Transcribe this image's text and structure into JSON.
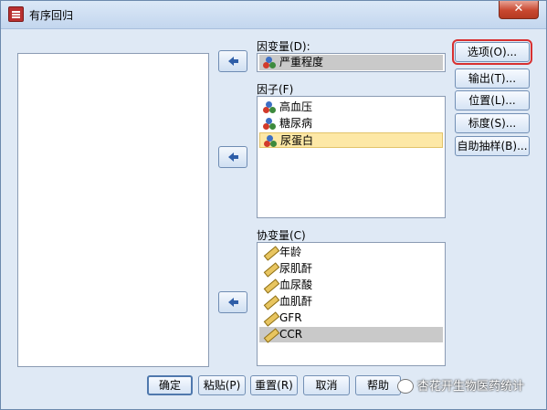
{
  "window": {
    "title": "有序回归",
    "close_label": "✕"
  },
  "dependent": {
    "label": "因变量(D):",
    "item": {
      "label": "严重程度",
      "icon": "nominal-icon"
    }
  },
  "factors": {
    "label": "因子(F)",
    "items": [
      {
        "label": "高血压",
        "icon": "nominal-icon"
      },
      {
        "label": "糖尿病",
        "icon": "nominal-icon"
      },
      {
        "label": "尿蛋白",
        "icon": "nominal-icon"
      }
    ]
  },
  "covariates": {
    "label": "协变量(C)",
    "items": [
      {
        "label": "年龄",
        "icon": "scale-icon"
      },
      {
        "label": "尿肌酐",
        "icon": "scale-icon"
      },
      {
        "label": "血尿酸",
        "icon": "scale-icon"
      },
      {
        "label": "血肌酐",
        "icon": "scale-icon"
      },
      {
        "label": "GFR",
        "icon": "scale-icon"
      },
      {
        "label": "CCR",
        "icon": "scale-icon"
      }
    ]
  },
  "side_buttons": {
    "options": "选项(O)...",
    "output": "输出(T)...",
    "location": "位置(L)...",
    "scale": "标度(S)...",
    "bootstrap": "自助抽样(B)..."
  },
  "bottom_buttons": {
    "ok": "确定",
    "paste": "粘贴(P)",
    "reset": "重置(R)",
    "cancel": "取消",
    "help": "帮助"
  },
  "watermark": "杏花开生物医药统计",
  "colors": {
    "accent": "#4f78ad",
    "focus": "#d83030",
    "selection": "#fde8a6"
  }
}
